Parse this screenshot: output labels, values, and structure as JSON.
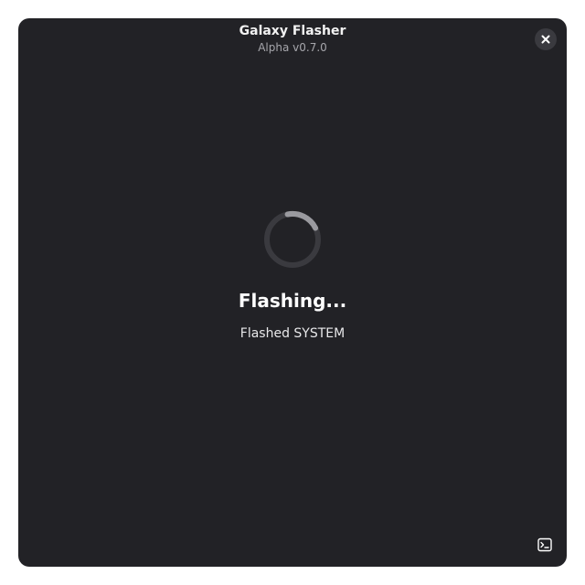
{
  "app": {
    "title": "Galaxy Flasher",
    "version": "Alpha v0.7.0"
  },
  "status": {
    "title": "Flashing...",
    "detail": "Flashed SYSTEM"
  },
  "icons": {
    "close": "close-icon",
    "spinner": "spinner-icon",
    "terminal": "terminal-icon"
  },
  "colors": {
    "window_bg": "#222226",
    "spinner_track": "#3a3a3f",
    "spinner_arc": "#9a9a9f"
  }
}
